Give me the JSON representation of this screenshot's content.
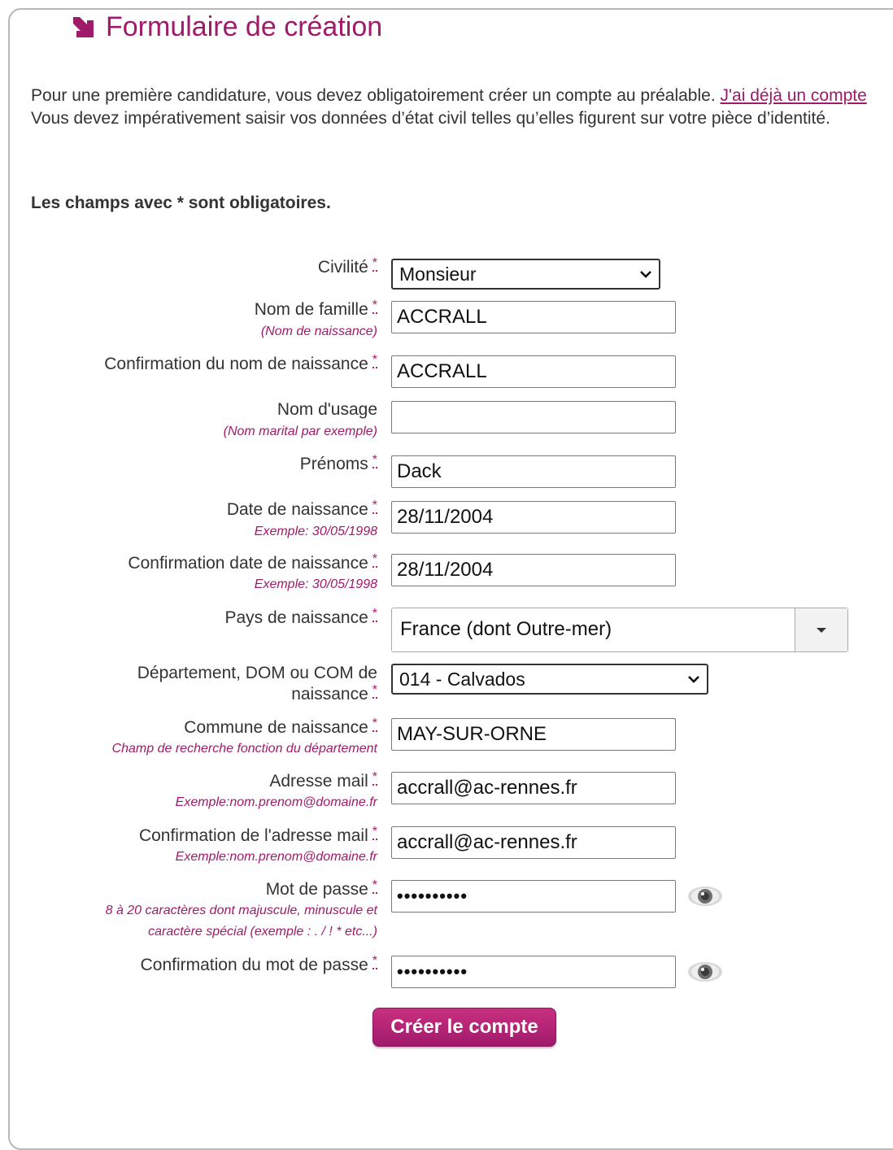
{
  "title": "Formulaire de création",
  "intro": {
    "text_before": "Pour une première candidature, vous devez obligatoirement créer un compte au préalable. ",
    "link": "J'ai déjà un compte",
    "text_after": " Vous devez impérativement saisir vos données d’état civil telles qu’elles figurent sur votre pièce d’identité."
  },
  "required_note": "Les champs avec * sont obligatoires.",
  "star": "*",
  "fields": {
    "civilite": {
      "label": "Civilité",
      "value": "Monsieur"
    },
    "nom": {
      "label": "Nom de famille",
      "hint": "(Nom de naissance)",
      "value": "ACCRALL"
    },
    "nom_confirm": {
      "label": "Confirmation du nom de naissance",
      "value": "ACCRALL"
    },
    "nom_usage": {
      "label": "Nom d'usage",
      "hint": "(Nom marital par exemple)",
      "value": ""
    },
    "prenoms": {
      "label": "Prénoms",
      "value": "Dack"
    },
    "date": {
      "label": "Date de naissance",
      "hint": "Exemple: 30/05/1998",
      "value": "28/11/2004"
    },
    "date_confirm": {
      "label": "Confirmation date de naissance",
      "hint": "Exemple: 30/05/1998",
      "value": "28/11/2004"
    },
    "pays": {
      "label": "Pays de naissance",
      "value": "France (dont Outre-mer)"
    },
    "departement": {
      "label_line1": "Département, DOM ou COM de",
      "label_line2": "naissance",
      "value": "014 - Calvados"
    },
    "commune": {
      "label": "Commune de naissance",
      "hint": "Champ de recherche fonction du département",
      "value": "MAY-SUR-ORNE"
    },
    "email": {
      "label": "Adresse mail",
      "hint": "Exemple:nom.prenom@domaine.fr",
      "value": "accrall@ac-rennes.fr"
    },
    "email_confirm": {
      "label": "Confirmation de l'adresse mail",
      "hint": "Exemple:nom.prenom@domaine.fr",
      "value": "accrall@ac-rennes.fr"
    },
    "password": {
      "label": "Mot de passe",
      "hint_line1": "8 à 20 caractères dont majuscule, minuscule et",
      "hint_line2": "caractère spécial (exemple : . / ! * etc...)",
      "value": "••••••••••"
    },
    "password_confirm": {
      "label": "Confirmation du mot de passe",
      "value": "••••••••••"
    }
  },
  "submit_label": "Créer le compte",
  "colors": {
    "accent": "#a01a6b",
    "text": "#333333"
  },
  "icons": [
    "arrow-icon",
    "chevron-down-icon",
    "caret-down-icon",
    "eye-icon"
  ]
}
